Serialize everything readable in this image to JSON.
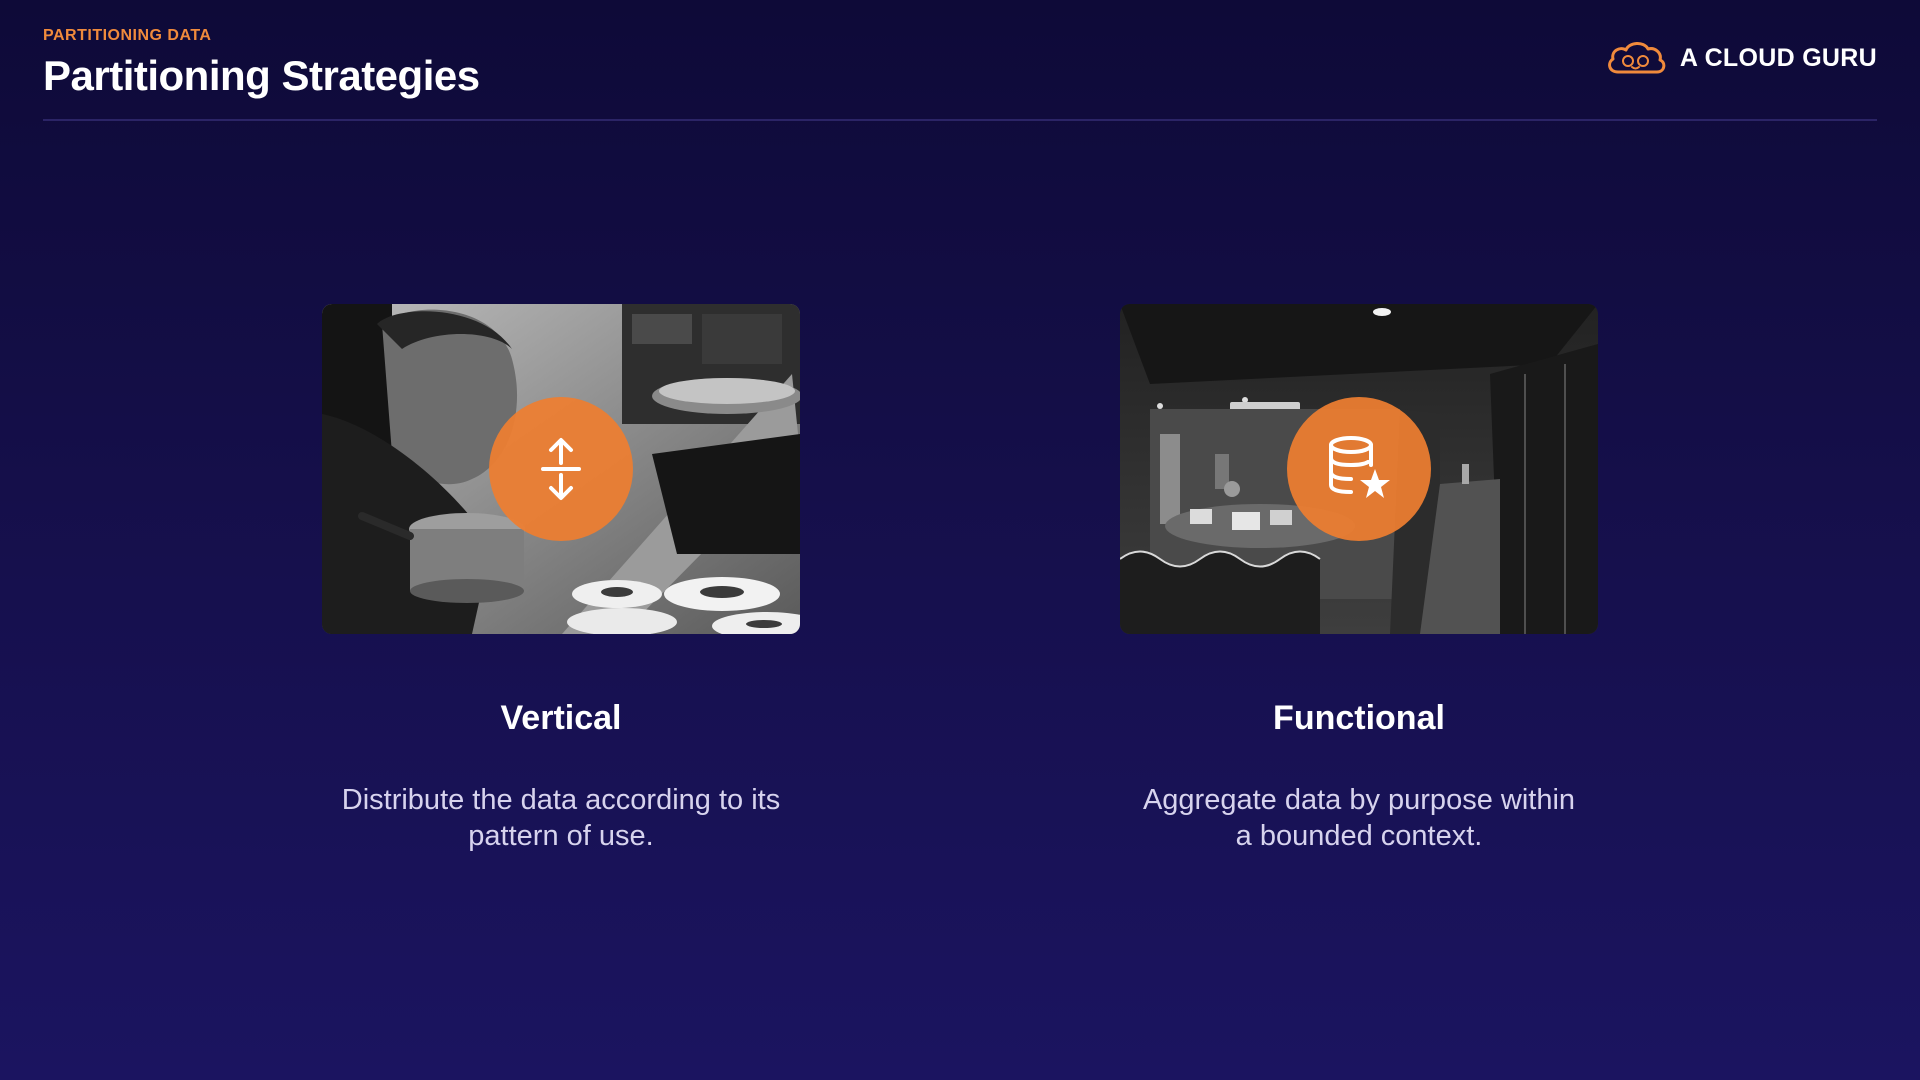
{
  "header": {
    "eyebrow": "PARTITIONING DATA",
    "title": "Partitioning Strategies"
  },
  "brand": {
    "name": "A CLOUD GURU",
    "logo_icon": "cloud-logo-icon"
  },
  "cards": [
    {
      "title": "Vertical",
      "description": "Distribute the data according to its pattern of use.",
      "image": "photo-chef-plating",
      "icon": "vertical-split-arrows-icon"
    },
    {
      "title": "Functional",
      "description": "Aggregate data by purpose within a bounded context.",
      "image": "photo-office-meeting-room",
      "icon": "database-star-icon"
    }
  ],
  "colors": {
    "background_top": "#0e0a38",
    "background_bottom": "#1b1460",
    "accent_orange": "#f08a3c",
    "badge_orange": "#ee7e30",
    "text_muted": "#d7d3ee"
  }
}
